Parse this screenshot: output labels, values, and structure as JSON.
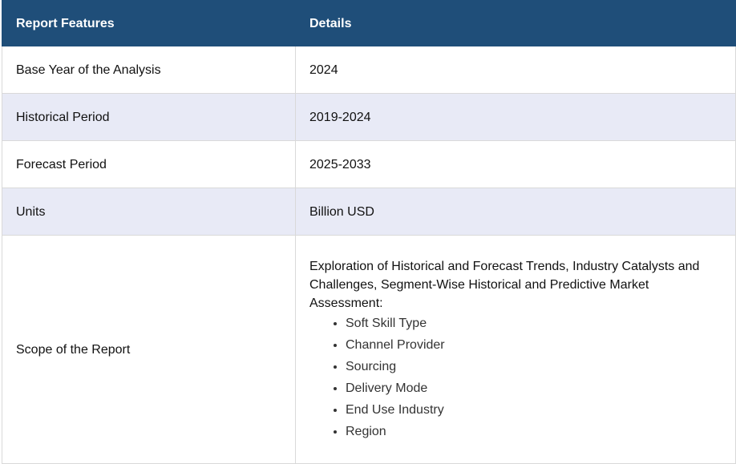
{
  "table": {
    "headers": [
      "Report Features",
      "Details"
    ],
    "rows": [
      {
        "feature": "Base Year of the Analysis",
        "detail": "2024"
      },
      {
        "feature": "Historical Period",
        "detail": "2019-2024"
      },
      {
        "feature": "Forecast Period",
        "detail": "2025-2033"
      },
      {
        "feature": "Units",
        "detail": "Billion USD"
      }
    ],
    "scope": {
      "feature": "Scope of the Report",
      "intro": "Exploration of Historical and Forecast Trends, Industry Catalysts and Challenges, Segment-Wise Historical and Predictive Market Assessment:",
      "items": [
        "Soft Skill Type",
        "Channel Provider",
        "Sourcing",
        "Delivery Mode",
        "End Use Industry",
        "Region"
      ]
    }
  },
  "colors": {
    "header_bg": "#1f4e79",
    "alt_row_bg": "#e8eaf6",
    "border": "#d9d9d9"
  }
}
